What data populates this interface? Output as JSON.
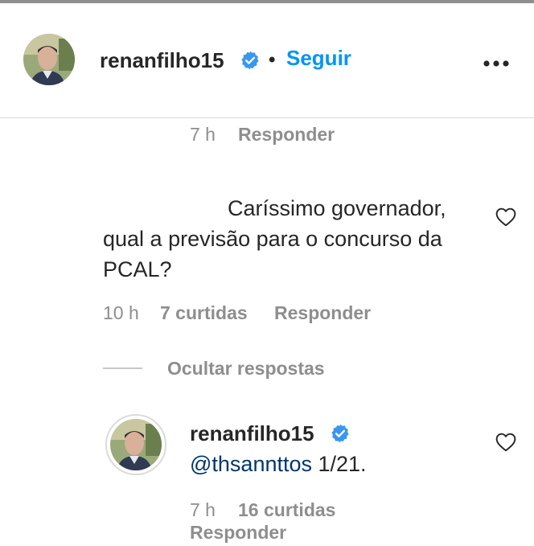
{
  "header": {
    "username": "renanfilho15",
    "separator": "•",
    "follow_label": "Seguir"
  },
  "previous_comment": {
    "time": "7 h",
    "reply_label": "Responder"
  },
  "comment": {
    "line1": "Caríssimo governador,",
    "line2": "qual a previsão para o concurso da",
    "line3": "PCAL?",
    "time": "10 h",
    "likes": "7 curtidas",
    "reply_label": "Responder",
    "hide_replies_label": "Ocultar respostas"
  },
  "reply": {
    "username": "renanfilho15",
    "mention": "@thsannttos",
    "text": " 1/21.",
    "time": "7 h",
    "likes": "16 curtidas",
    "reply_label": "Responder"
  },
  "colors": {
    "accent": "#0095f6",
    "mention": "#00376b",
    "muted": "#8e8e8e",
    "text": "#262626"
  },
  "icons": [
    "verified-badge-icon",
    "more-options-icon",
    "heart-icon"
  ]
}
